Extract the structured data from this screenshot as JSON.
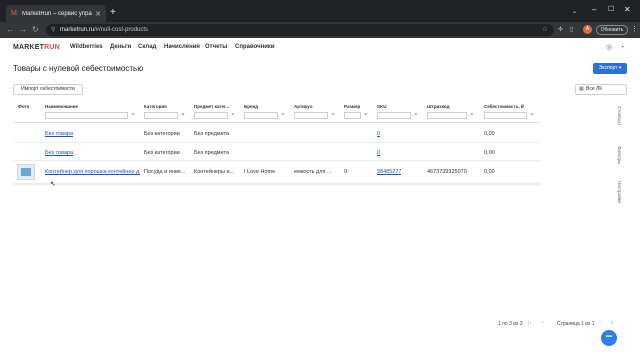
{
  "browser": {
    "tab_title": "MarketRun – сервис управлен...",
    "url_domain": "marketrun.ru",
    "url_path": "/#/null-cost-products",
    "update_label": "Обновить",
    "profile_initial": "А"
  },
  "nav": {
    "logo_market": "MARKET",
    "logo_run": "RUN",
    "items": [
      "Wildberries",
      "Деньги",
      "Склад",
      "Начисления",
      "Отчеты",
      "Справочники"
    ]
  },
  "page": {
    "title": "Товары с нулевой себестоимостью",
    "export_label": "Экспорт",
    "import_label": "Импорт себестоимости",
    "lk_select": "Все ЛК"
  },
  "table": {
    "columns": [
      "Фото",
      "Наименование",
      "Категория",
      "Предмет катег...",
      "Бренд",
      "Артикул",
      "Размер",
      "SKU",
      "Штрихкод",
      "Себестоимость, ₽"
    ],
    "rows": [
      {
        "name": "Без товара",
        "category": "Без категории",
        "subject": "Без предмета",
        "brand": "",
        "article": "",
        "size": "",
        "sku": "0",
        "barcode": "",
        "cost": "0,00",
        "has_photo": false
      },
      {
        "name": "Без товара",
        "category": "Без категории",
        "subject": "Без предмета",
        "brand": "",
        "article": "",
        "size": "",
        "sku": "0",
        "barcode": "",
        "cost": "0,00",
        "has_photo": false
      },
      {
        "name": "Контейнер для порошка контейнер д...",
        "category": "Посуда и инве...",
        "subject": "Контейнеры и...",
        "brand": "I Love Home",
        "article": "емкость для ...",
        "size": "0",
        "sku": "98485277",
        "barcode": "4673739325070",
        "cost": "0,00",
        "has_photo": true
      }
    ]
  },
  "side_tabs": [
    "Столбцы",
    "Фильтры",
    "Настройки"
  ],
  "pagination": {
    "range": "1 по 3 из 3",
    "page": "Страница 1 из 1"
  },
  "chat_label": "•••"
}
